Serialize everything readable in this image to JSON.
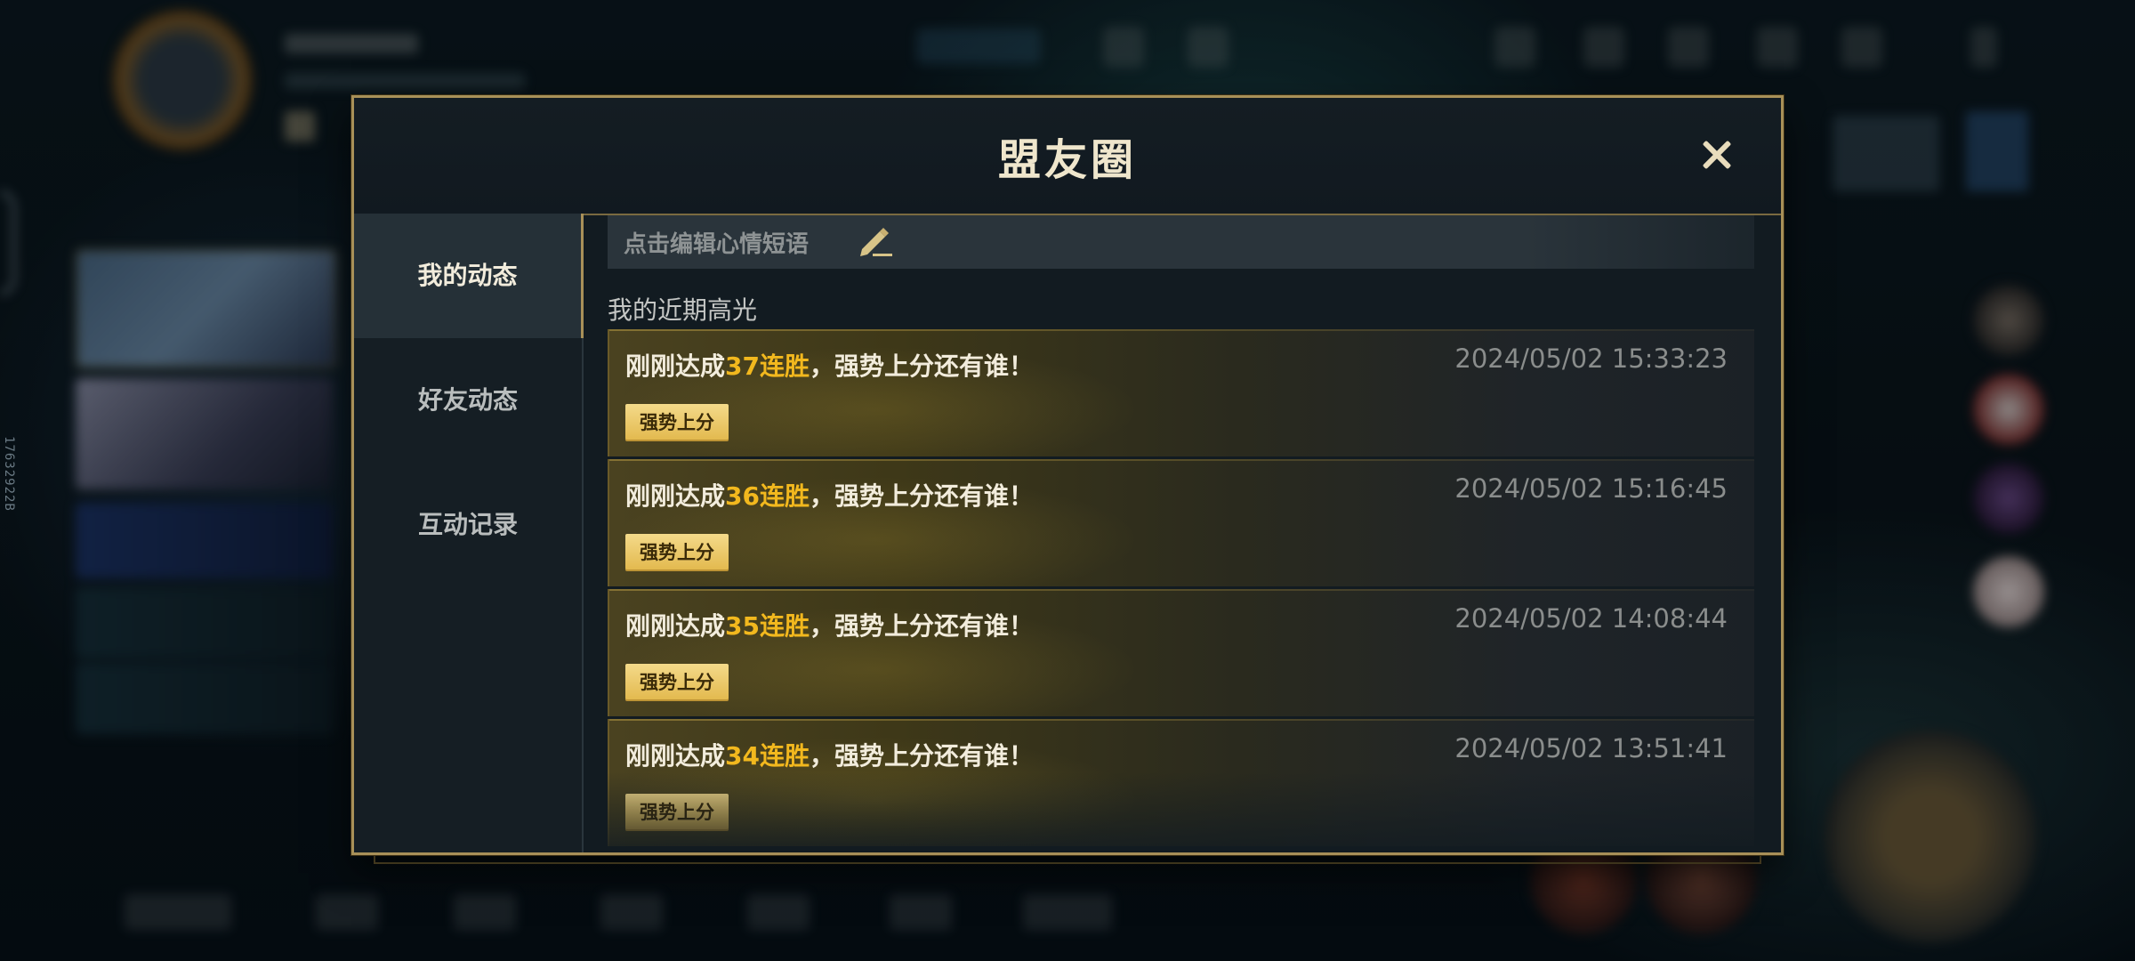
{
  "modal": {
    "title": "盟友圈",
    "tabs": [
      {
        "label": "我的动态",
        "active": true
      },
      {
        "label": "好友动态",
        "active": false
      },
      {
        "label": "互动记录",
        "active": false
      }
    ],
    "mood_placeholder": "点击编辑心情短语",
    "section_label": "我的近期高光",
    "feed": [
      {
        "prefix": "刚刚达成",
        "highlight": "37连胜",
        "suffix": "，强势上分还有谁！",
        "time": "2024/05/02 15:33:23",
        "tag": "强势上分"
      },
      {
        "prefix": "刚刚达成",
        "highlight": "36连胜",
        "suffix": "，强势上分还有谁！",
        "time": "2024/05/02 15:16:45",
        "tag": "强势上分"
      },
      {
        "prefix": "刚刚达成",
        "highlight": "35连胜",
        "suffix": "，强势上分还有谁！",
        "time": "2024/05/02 14:08:44",
        "tag": "强势上分"
      },
      {
        "prefix": "刚刚达成",
        "highlight": "34连胜",
        "suffix": "，强势上分还有谁！",
        "time": "2024/05/02 13:51:41",
        "tag": "强势上分"
      }
    ]
  },
  "colors": {
    "accent_gold": "#f2b81e",
    "border_gold": "#a89058",
    "panel_bg": "#121b21"
  }
}
